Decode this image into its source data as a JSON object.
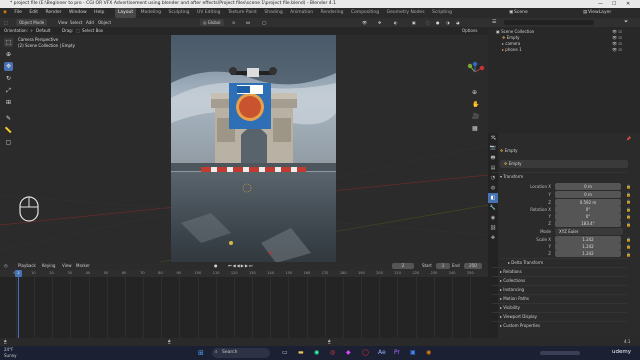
{
  "title_bar": {
    "title": "* project file (E:\\Beginner to pro - CGI OR VFX Advertisement using blender and after effects\\Project files\\scene 1\\project file.blend) - Blender 4.1"
  },
  "menu": {
    "items": [
      "File",
      "Edit",
      "Render",
      "Window",
      "Help"
    ],
    "workspaces": [
      "Layout",
      "Modeling",
      "Sculpting",
      "UV Editing",
      "Texture Paint",
      "Shading",
      "Animation",
      "Rendering",
      "Compositing",
      "Geometry Nodes",
      "Scripting"
    ],
    "active_workspace": "Layout",
    "scene": "Scene",
    "view_layer": "ViewLayer"
  },
  "viewport_header": {
    "mode": "Object Mode",
    "view": "View",
    "select": "Select",
    "add": "Add",
    "object": "Object",
    "orientation_label": "Orientation:",
    "orientation_value": "Default",
    "drag_label": "Drag:",
    "drag_value": "Select Box",
    "transform_space": "Global",
    "options": "Options"
  },
  "viewport": {
    "overlay_line1": "Camera Perspective",
    "overlay_line2": "(2) Scene Collection | Empty"
  },
  "timeline": {
    "menu": [
      "Playback",
      "Keying",
      "View",
      "Marker"
    ],
    "current_frame": "2",
    "start_label": "Start",
    "start_value": "1",
    "end_label": "End",
    "end_value": "250",
    "ruler": [
      "0",
      "10",
      "20",
      "30",
      "40",
      "50",
      "60",
      "70",
      "80",
      "90",
      "100",
      "110",
      "120",
      "130",
      "140",
      "150",
      "160",
      "170",
      "180",
      "190",
      "200",
      "210",
      "220",
      "230",
      "240",
      "250"
    ],
    "playhead_label": "2"
  },
  "outliner": {
    "root": "Scene Collection",
    "items": [
      "Empty",
      "camera",
      "phone 1"
    ]
  },
  "properties": {
    "object_name": "Empty",
    "data_name": "Empty",
    "transform_title": "Transform",
    "location_label": "Location X",
    "location": [
      "0 m",
      "0 m",
      "0.592 m"
    ],
    "rotation_label": "Rotation X",
    "rotation": [
      "0°",
      "0°",
      "183.4°"
    ],
    "mode_label": "Mode",
    "mode_value": "XYZ Euler",
    "scale_label": "Scale X",
    "scale": [
      "1.242",
      "1.242",
      "1.242"
    ],
    "axis_y": "Y",
    "axis_z": "Z",
    "delta_transform": "Delta Transform",
    "sections": [
      "Relations",
      "Collections",
      "Instancing",
      "Motion Paths",
      "Visibility",
      "Viewport Display",
      "Custom Properties"
    ]
  },
  "status_bar": {
    "version": "4.1"
  },
  "taskbar": {
    "weather_temp": "24°F",
    "weather_desc": "Sunny",
    "search_placeholder": "Search",
    "watermark": "udemy"
  }
}
